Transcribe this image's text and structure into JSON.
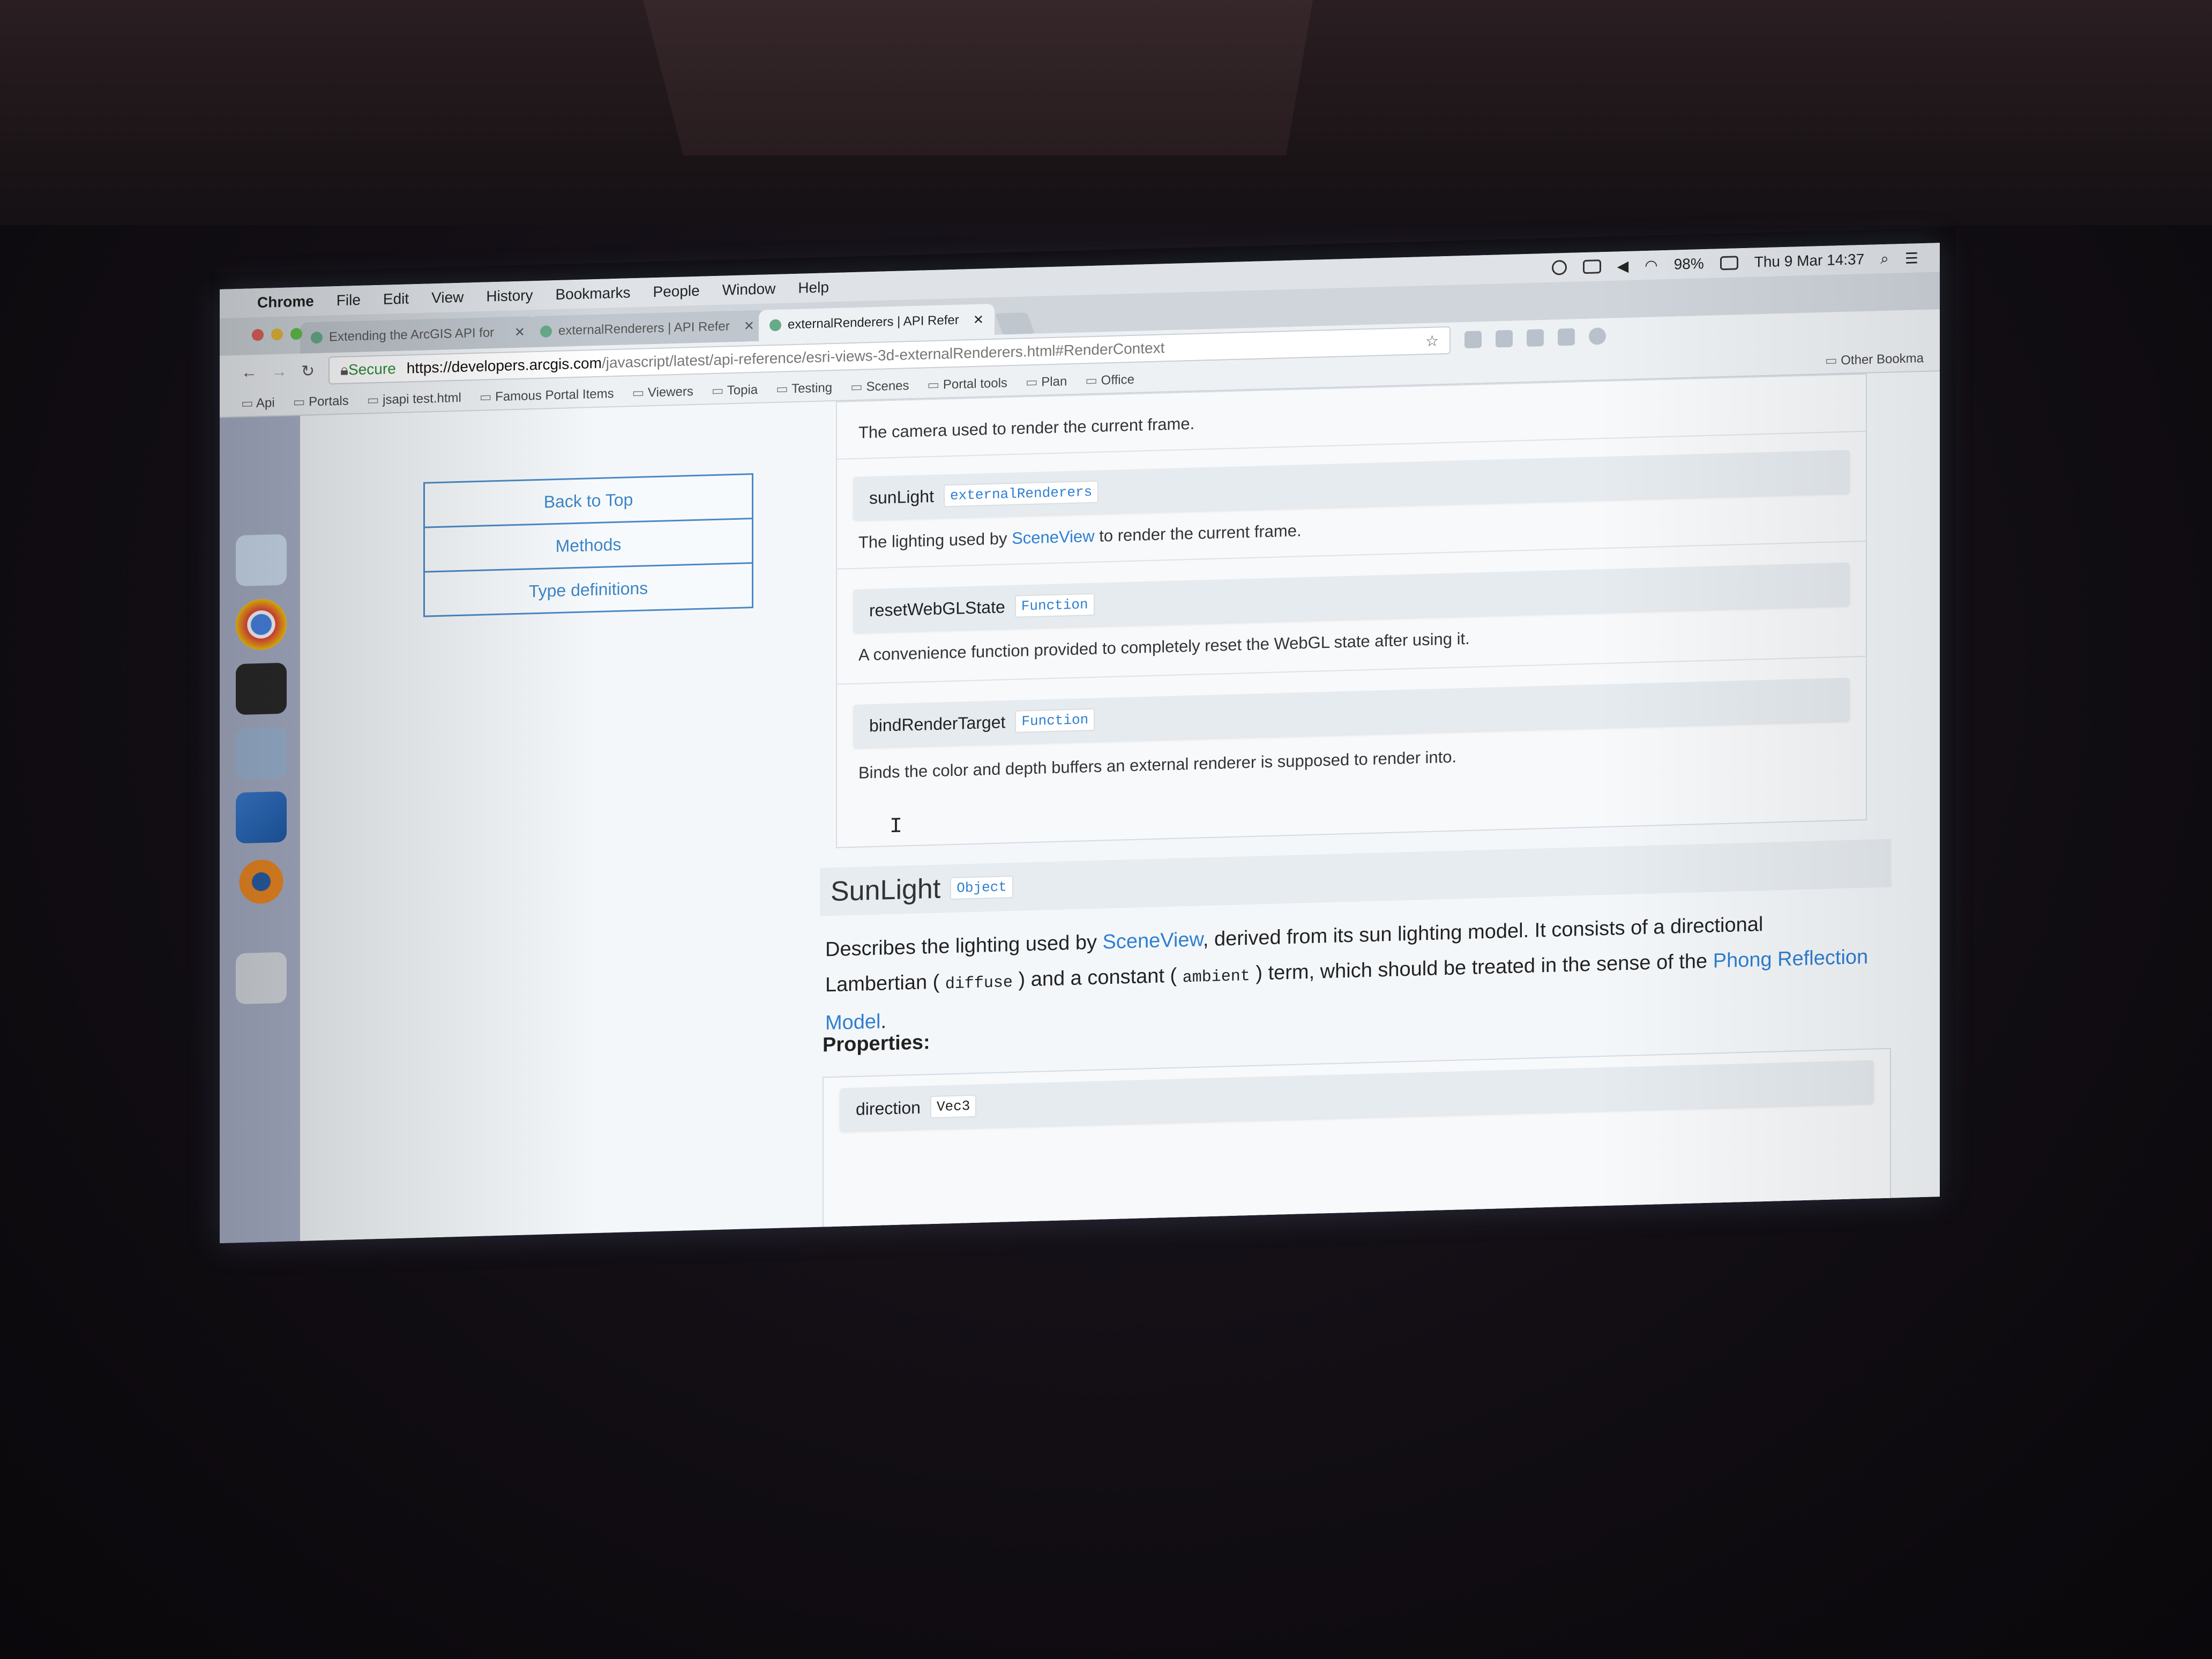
{
  "menubar": {
    "app": "Chrome",
    "items": [
      "File",
      "Edit",
      "View",
      "History",
      "Bookmarks",
      "People",
      "Window",
      "Help"
    ],
    "battery": "98%",
    "clock": "Thu 9 Mar  14:37"
  },
  "tabs": [
    {
      "label": "Extending the ArcGIS API for",
      "active": false
    },
    {
      "label": "externalRenderers | API Refer",
      "active": false
    },
    {
      "label": "externalRenderers | API Refer",
      "active": true
    }
  ],
  "address": {
    "secure": "Secure",
    "host": "https://developers.arcgis.com",
    "path": "/javascript/latest/api-reference/esri-views-3d-externalRenderers.html#RenderContext"
  },
  "bookmarks": [
    "Api",
    "Portals",
    "jsapi test.html",
    "Famous Portal Items",
    "Viewers",
    "Topia",
    "Testing",
    "Scenes",
    "Portal tools",
    "Plan",
    "Office"
  ],
  "other_bookmarks": "Other Bookma",
  "nav": {
    "back_to_top": "Back to Top",
    "methods": "Methods",
    "type_definitions": "Type definitions"
  },
  "properties": {
    "camera_desc": "The camera used to render the current frame.",
    "sunlight": {
      "name": "sunLight",
      "type": "externalRenderers",
      "desc_pre": "The lighting used by ",
      "desc_link": "SceneView",
      "desc_post": " to render the current frame."
    },
    "reset": {
      "name": "resetWebGLState",
      "type": "Function",
      "desc": "A convenience function provided to completely reset the WebGL state after using it."
    },
    "bind": {
      "name": "bindRenderTarget",
      "type": "Function",
      "desc": "Binds the color and depth buffers an external renderer is supposed to render into."
    }
  },
  "section": {
    "title": "SunLight",
    "type": "Object",
    "desc_1": "Describes the lighting used by ",
    "desc_link_1": "SceneView",
    "desc_2": ", derived from its sun lighting model. It consists of a directional Lambertian ( ",
    "code_1": "diffuse",
    "desc_3": " ) and a constant ( ",
    "code_2": "ambient",
    "desc_4": " ) term, which should be treated in the sense of the ",
    "desc_link_2": "Phong Reflection Model",
    "desc_5": ".",
    "properties_label": "Properties:",
    "first_prop": "direction",
    "first_prop_type": "Vec3"
  }
}
